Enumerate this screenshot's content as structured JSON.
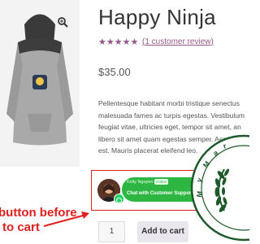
{
  "product": {
    "title": "Happy Ninja",
    "rating_stars": "★★★★★",
    "rating": 5,
    "review_link": "1 customer review",
    "price": "$35.00",
    "description_lines": [
      "Pellentesque habitant morbi tristique senectus",
      "malesuada fames ac turpis egestas. Vestibulum",
      "feugiat vitae, ultricies eget, tempor sit amet, an",
      "libero sit amet quam egestas semper. Aenean",
      "est. Mauris placerat eleifend leo."
    ],
    "gallery_icons": [
      "magnifier-zoom-icon"
    ]
  },
  "chat": {
    "agent_name": "Kelly Nguyen",
    "status": "Online",
    "cta": "Chat with Customer Support",
    "icons": [
      "whatsapp-icon",
      "avatar"
    ],
    "accent_color": "#2db742",
    "highlight_color": "#e01f1f"
  },
  "annotation": {
    "line1": "button before",
    "line2": "to cart"
  },
  "cart": {
    "quantity": "1",
    "add_to_cart_label": "Add to cart"
  },
  "seal": {
    "text": "M y   M a r"
  },
  "colors": {
    "rating": "#96588a",
    "annotation": "#e01f1f",
    "button_bg": "#e9e6ed"
  }
}
